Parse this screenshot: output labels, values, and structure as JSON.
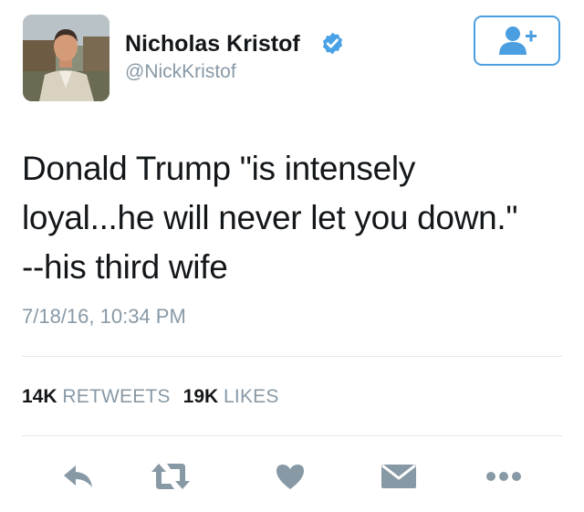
{
  "author": {
    "name": "Nicholas Kristof",
    "handle": "@NickKristof",
    "verified": true
  },
  "tweet": {
    "lines": [
      "Donald Trump \"is intensely",
      "loyal...he will never let you down.\"",
      "--his third wife"
    ],
    "timestamp": "7/18/16, 10:34 PM"
  },
  "stats": {
    "retweets_count": "14K",
    "retweets_label": "RETWEETS",
    "likes_count": "19K",
    "likes_label": "LIKES"
  },
  "icons": {
    "follow": "add-user-icon",
    "verified": "verified-badge-icon",
    "reply": "reply-icon",
    "retweet": "retweet-icon",
    "like": "heart-icon",
    "message": "envelope-icon",
    "more": "more-icon"
  },
  "colors": {
    "accent": "#1da1f2",
    "icon_gray": "#8899a6",
    "text": "#14171a",
    "secondary_text": "#8899a6"
  }
}
